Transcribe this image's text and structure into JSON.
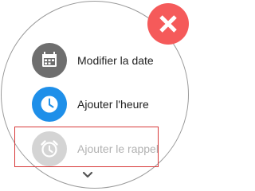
{
  "menu": {
    "items": [
      {
        "label": "Modifier la date",
        "icon": "calendar-icon",
        "color": "#6e6e6e",
        "enabled": true
      },
      {
        "label": "Ajouter l'heure",
        "icon": "clock-icon",
        "color": "#1e8fe9",
        "enabled": true
      },
      {
        "label": "Ajouter le rappel",
        "icon": "alarm-clock-icon",
        "color": "#d4d4d4",
        "enabled": false
      }
    ]
  },
  "close_button": {
    "icon": "close-icon",
    "color": "#f55a5a"
  },
  "scroll_indicator": {
    "icon": "chevron-down-icon"
  },
  "highlight": {
    "color": "#d83a3a",
    "target": "menu.items.2"
  }
}
